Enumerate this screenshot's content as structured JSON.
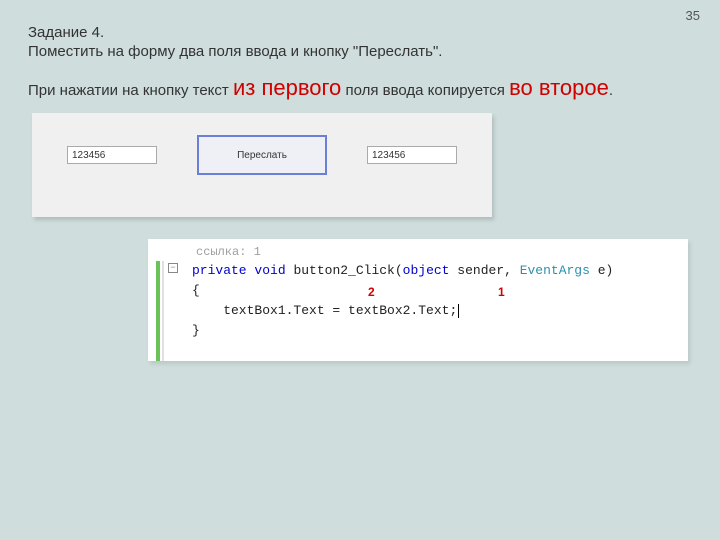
{
  "page_number": "35",
  "task": {
    "title": "Задание 4.",
    "line1": "Поместить на форму два поля ввода и кнопку \"Переслать\".",
    "line2a": "При нажатии на кнопку текст ",
    "em1": "из первого",
    "line2b": " поля ввода копируется ",
    "em2": "во второе",
    "period": "."
  },
  "form": {
    "textbox1": "123456",
    "button_label": "Переслать",
    "textbox2": "123456"
  },
  "code": {
    "ref_label": "ссылка: 1",
    "fold_glyph": "−",
    "sig": {
      "kw1": "private",
      "kw2": "void",
      "name": " button2_Click(",
      "kw3": "object",
      "arg1": " sender, ",
      "type": "EventArgs",
      "arg2": " e)"
    },
    "brace_open": "{",
    "body": "    textBox1.Text = textBox2.Text;",
    "brace_close": "}",
    "anno_left": "2",
    "anno_right": "1"
  }
}
